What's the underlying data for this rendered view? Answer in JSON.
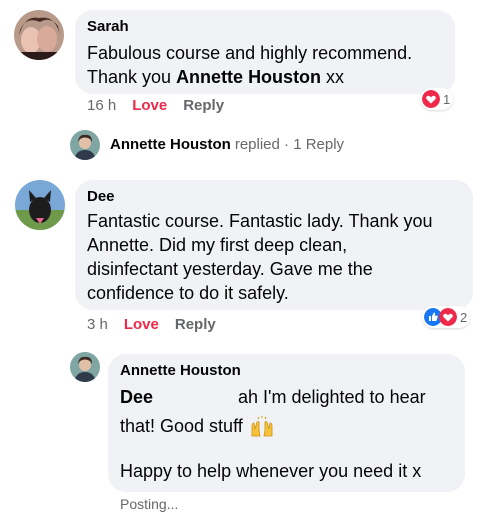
{
  "comments": [
    {
      "author": "Sarah",
      "text_line1": "Fabulous course and highly recommend.",
      "text_line2_prefix": "Thank you ",
      "text_line2_bold": "Annette Houston",
      "text_line2_suffix": " xx",
      "time": "16 h",
      "love_label": "Love",
      "reply_label": "Reply",
      "reaction_count": "1"
    },
    {
      "author": "Dee",
      "text_lines": [
        "Fantastic course. Fantastic lady. Thank you",
        "Annette. Did my first deep clean,",
        "disinfectant yesterday. Gave me the",
        "confidence to do it safely."
      ],
      "time": "3 h",
      "love_label": "Love",
      "reply_label": "Reply",
      "reaction_count": "2"
    }
  ],
  "replied": {
    "name": "Annette Houston",
    "text": "replied · 1 Reply"
  },
  "reply": {
    "author": "Annette Houston",
    "mention": "Dee",
    "line1_rest": "ah I'm delighted to hear",
    "line2": "that! Good stuff",
    "line3": "Happy to help whenever you need it x",
    "status": "Posting..."
  },
  "colors": {
    "bubble": "#f0f2f5",
    "love": "#f0284a",
    "like": "#1877f2",
    "meta": "#65676b"
  },
  "icons": [
    "love-reaction-icon",
    "like-reaction-icon",
    "raising-hands-emoji"
  ]
}
